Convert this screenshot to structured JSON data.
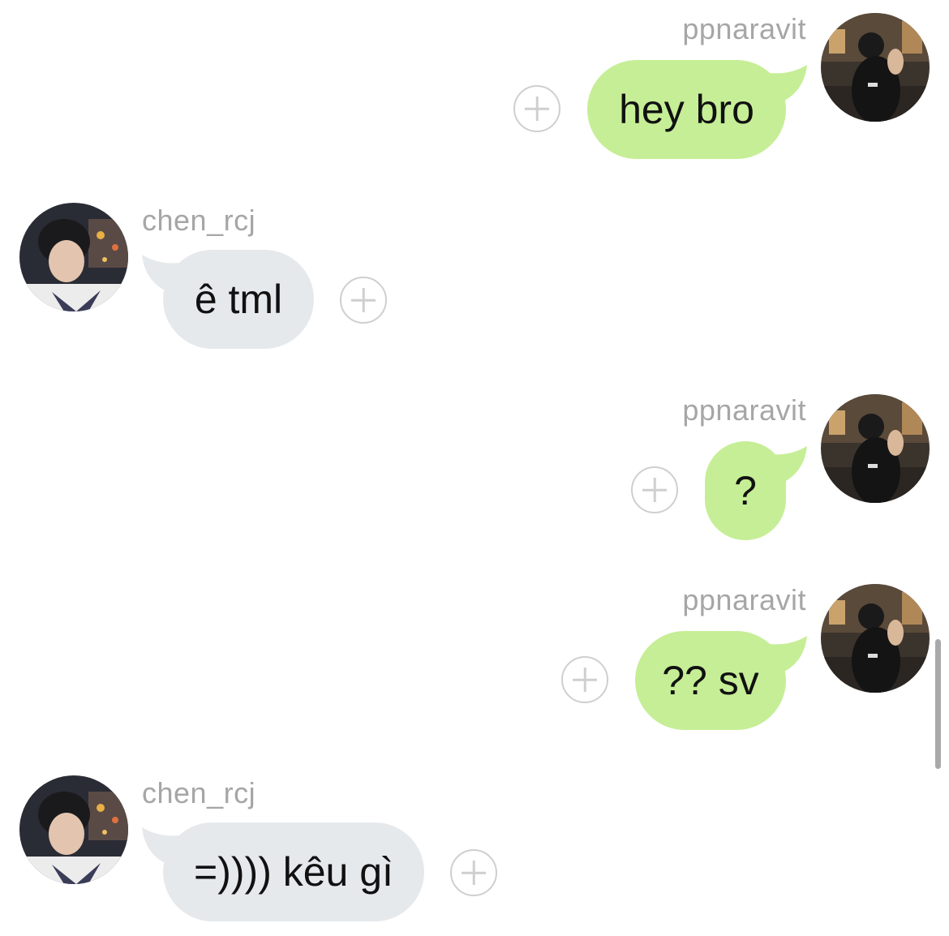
{
  "messages": [
    {
      "sender": "ppnaravit",
      "direction": "outgoing",
      "text": "hey bro",
      "avatar": "avatar-ppnaravit"
    },
    {
      "sender": "chen_rcj",
      "direction": "incoming",
      "text": "ê tml",
      "avatar": "avatar-chen_rcj"
    },
    {
      "sender": "ppnaravit",
      "direction": "outgoing",
      "text": "?",
      "avatar": "avatar-ppnaravit"
    },
    {
      "sender": "ppnaravit",
      "direction": "outgoing",
      "text": "?? sv",
      "avatar": "avatar-ppnaravit"
    },
    {
      "sender": "chen_rcj",
      "direction": "incoming",
      "text": "=)))) kêu gì",
      "avatar": "avatar-chen_rcj"
    }
  ],
  "icons": {
    "react": "plus-circle-icon"
  },
  "colors": {
    "outgoing_bubble": "#c6ee96",
    "incoming_bubble": "#e6e9ec",
    "username": "#a6a6a6",
    "background": "#ffffff"
  }
}
